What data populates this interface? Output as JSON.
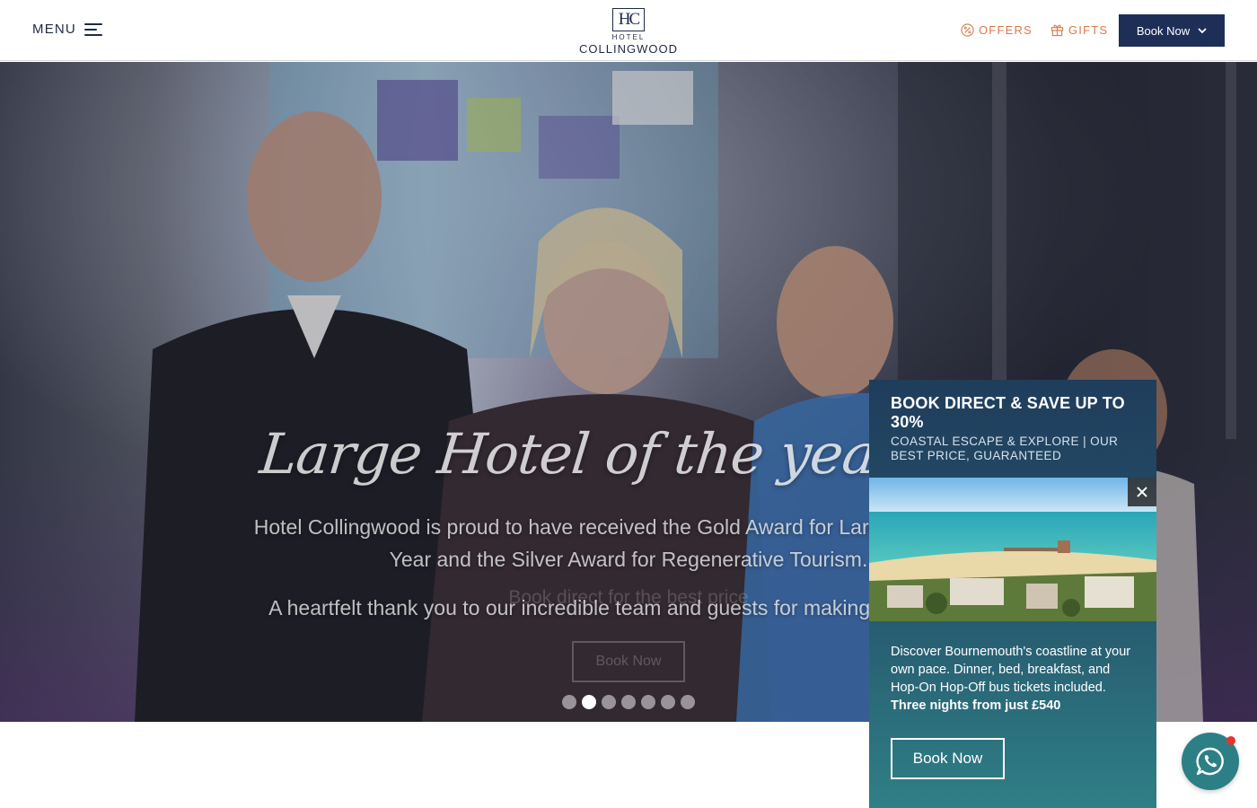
{
  "header": {
    "menu_label": "MENU",
    "logo": {
      "monogram": "HC",
      "small": "HOTEL",
      "name": "COLLINGWOOD"
    },
    "offers_label": "OFFERS",
    "gifts_label": "GIFTS",
    "book_label": "Book Now"
  },
  "hero": {
    "title": "Large Hotel of the year Winn",
    "paragraph1": "Hotel Collingwood is proud to have received the Gold Award for Large Hotel of the Year and the Silver Award for Regenerative Tourism.",
    "paragraph2": "A heartfelt thank you to our incredible team and guests for making this happen.",
    "ghost_text": "Book direct for the best price",
    "button_label": "Book Now",
    "slide_count": 7,
    "active_slide": 2
  },
  "popup": {
    "title": "BOOK DIRECT & SAVE UP TO 30%",
    "subtitle": "COASTAL ESCAPE & EXPLORE | OUR BEST PRICE, GUARANTEED",
    "body": "Discover Bournemouth's coastline at your own pace. Dinner, bed, breakfast, and Hop-On Hop-Off bus tickets included.",
    "body_bold": "Three nights from just £540",
    "button_label": "Book Now"
  },
  "colors": {
    "navy": "#1d2f57",
    "accent_orange": "#d97a4a",
    "teal": "#2d7f86"
  }
}
